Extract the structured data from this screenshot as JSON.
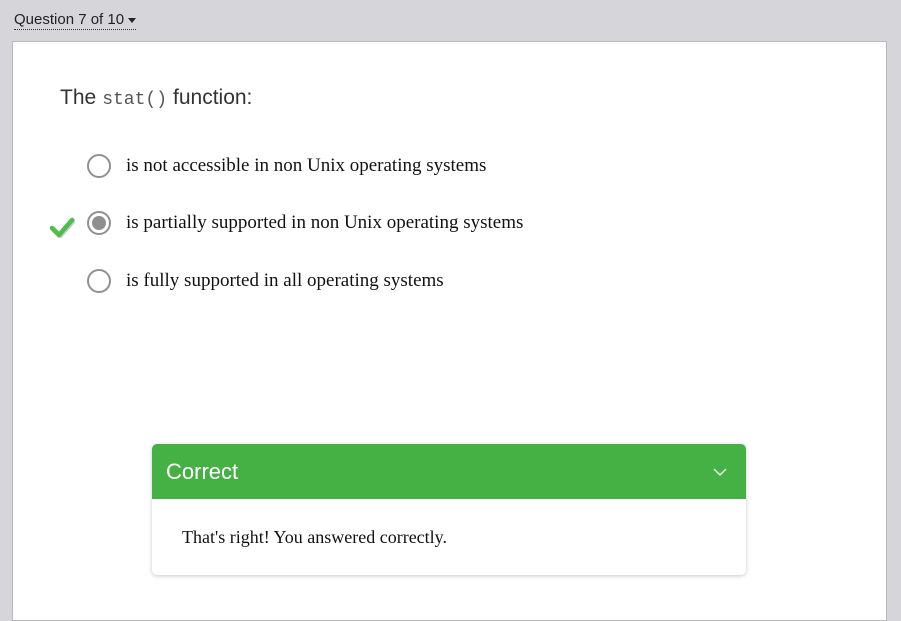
{
  "nav": {
    "question_label": "Question 7 of 10"
  },
  "question": {
    "prefix": "The",
    "code": "stat()",
    "suffix": "function:"
  },
  "options": [
    {
      "label": "is not accessible in non Unix operating systems",
      "selected": false
    },
    {
      "label": "is partially supported in non Unix operating systems",
      "selected": true,
      "correct": true
    },
    {
      "label": "is fully supported in all operating systems",
      "selected": false
    }
  ],
  "feedback": {
    "title": "Correct",
    "message": "That's right! You answered correctly.",
    "color": "#45b043"
  },
  "icons": {
    "correct_marker": "checkmark-icon",
    "expander": "chevron-down-icon",
    "nav_menu": "caret-down-icon"
  }
}
